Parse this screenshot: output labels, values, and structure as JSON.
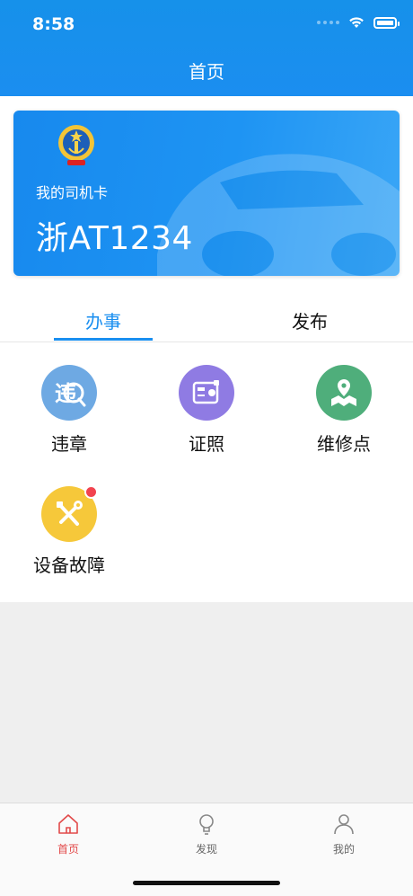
{
  "status_bar": {
    "time": "8:58"
  },
  "nav": {
    "title": "首页"
  },
  "card": {
    "label": "我的司机卡",
    "plate": "浙AT1234"
  },
  "tabs": [
    {
      "label": "办事"
    },
    {
      "label": "发布"
    }
  ],
  "services": [
    {
      "label": "违章",
      "icon": "violation-icon",
      "color": "#6ea9e3"
    },
    {
      "label": "证照",
      "icon": "license-icon",
      "color": "#8f7be3"
    },
    {
      "label": "维修点",
      "icon": "map-pin-icon",
      "color": "#4fae7b"
    },
    {
      "label": "设备故障",
      "icon": "tools-icon",
      "color": "#f6c83a"
    }
  ],
  "bottom_nav": [
    {
      "label": "首页",
      "icon": "home-icon",
      "active": true
    },
    {
      "label": "发现",
      "icon": "bulb-icon",
      "active": false
    },
    {
      "label": "我的",
      "icon": "person-icon",
      "active": false
    }
  ],
  "colors": {
    "primary": "#1a8ff0",
    "active_tab_bar": "#e24a4a",
    "badge": "#f2434f"
  }
}
